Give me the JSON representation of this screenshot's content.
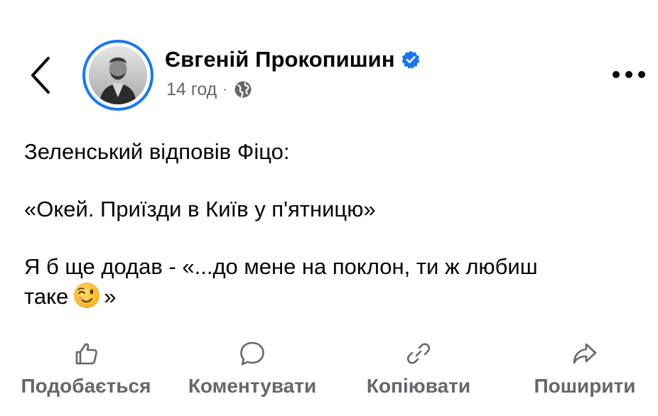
{
  "header": {
    "back_icon": "chevron-left-icon",
    "author_name": "Євгеній Прокопишин",
    "verified_icon": "verified-badge-icon",
    "time": "14 год",
    "separator": "·",
    "audience_icon": "globe-icon",
    "more_icon": "more-horizontal-icon"
  },
  "post": {
    "lines": [
      "Зеленський відповів Фіцо:",
      "«Окей. Приїзди в Київ у п'ятницю»",
      "Я б ще додав - «...до мене на поклон, ти ж любиш",
      "таке",
      "»"
    ],
    "emoji": "winking-face-emoji"
  },
  "actions": [
    {
      "label": "Подобається",
      "icon": "thumbs-up-icon"
    },
    {
      "label": "Коментувати",
      "icon": "comment-icon"
    },
    {
      "label": "Копіювати",
      "icon": "link-icon"
    },
    {
      "label": "Поширити",
      "icon": "share-icon"
    }
  ],
  "colors": {
    "accent": "#1877f2",
    "text": "#050505",
    "secondary_text": "#65676b"
  }
}
